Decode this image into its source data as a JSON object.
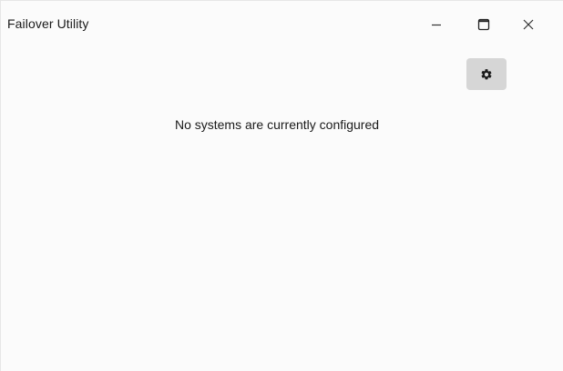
{
  "window": {
    "title": "Failover Utility"
  },
  "controls": {
    "minimize_icon": "minimize-icon",
    "maximize_icon": "maximize-icon",
    "close_icon": "close-icon",
    "settings_icon": "gear-icon"
  },
  "main": {
    "empty_message": "No systems are currently configured"
  },
  "colors": {
    "background": "#fbfbfb",
    "settings_button_bg": "#d6d6d6",
    "text": "#1a1a1a"
  }
}
